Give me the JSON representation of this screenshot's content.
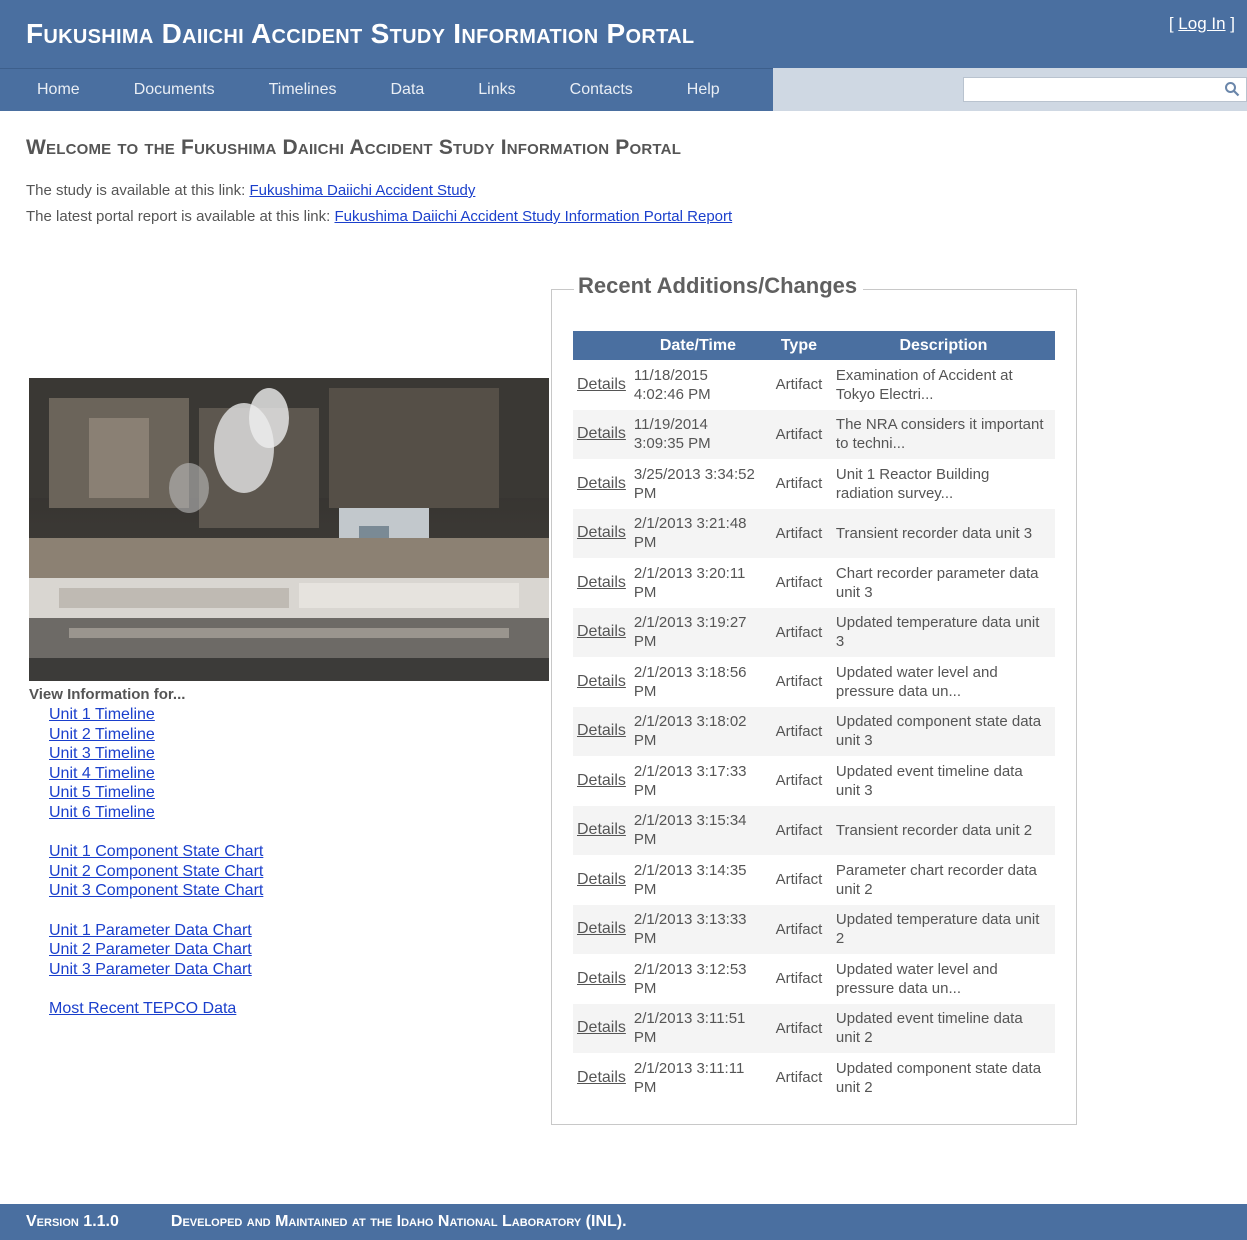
{
  "header": {
    "title": "Fukushima Daiichi Accident Study Information Portal",
    "login": "Log In"
  },
  "nav": {
    "items": [
      "Home",
      "Documents",
      "Timelines",
      "Data",
      "Links",
      "Contacts",
      "Help"
    ],
    "search_placeholder": ""
  },
  "main": {
    "heading": "Welcome to the Fukushima Daiichi Accident Study Information Portal",
    "study_text": "The study is available at this link: ",
    "study_link": "Fukushima Daiichi Accident Study",
    "report_text": "The latest portal report is available at this link: ",
    "report_link": "Fukushima Daiichi Accident Study Information Portal Report",
    "view_label": "View Information for...",
    "timelines": [
      "Unit 1 Timeline",
      "Unit 2 Timeline",
      "Unit 3 Timeline",
      "Unit 4 Timeline",
      "Unit 5 Timeline",
      "Unit 6 Timeline"
    ],
    "state_charts": [
      "Unit 1 Component State Chart",
      "Unit 2 Component State Chart",
      "Unit 3 Component State Chart"
    ],
    "param_charts": [
      "Unit 1 Parameter Data Chart",
      "Unit 2 Parameter Data Chart",
      "Unit 3 Parameter Data Chart"
    ],
    "tepco_link": "Most Recent TEPCO Data"
  },
  "recent": {
    "title": "Recent Additions/Changes",
    "columns": [
      "",
      "Date/Time",
      "Type",
      "Description"
    ],
    "rows": [
      {
        "link": "Details",
        "datetime": "11/18/2015 4:02:46 PM",
        "type": "Artifact",
        "description": "Examination of Accident at Tokyo Electri..."
      },
      {
        "link": "Details",
        "datetime": "11/19/2014 3:09:35 PM",
        "type": "Artifact",
        "description": "The NRA considers it important to techni..."
      },
      {
        "link": "Details",
        "datetime": "3/25/2013 3:34:52 PM",
        "type": "Artifact",
        "description": "Unit 1 Reactor Building radiation survey..."
      },
      {
        "link": "Details",
        "datetime": "2/1/2013 3:21:48 PM",
        "type": "Artifact",
        "description": "Transient recorder data unit 3"
      },
      {
        "link": "Details",
        "datetime": "2/1/2013 3:20:11 PM",
        "type": "Artifact",
        "description": "Chart recorder parameter data unit 3"
      },
      {
        "link": "Details",
        "datetime": "2/1/2013 3:19:27 PM",
        "type": "Artifact",
        "description": "Updated temperature data unit 3"
      },
      {
        "link": "Details",
        "datetime": "2/1/2013 3:18:56 PM",
        "type": "Artifact",
        "description": "Updated water level and pressure data un..."
      },
      {
        "link": "Details",
        "datetime": "2/1/2013 3:18:02 PM",
        "type": "Artifact",
        "description": "Updated component state data unit 3"
      },
      {
        "link": "Details",
        "datetime": "2/1/2013 3:17:33 PM",
        "type": "Artifact",
        "description": "Updated event timeline data unit 3"
      },
      {
        "link": "Details",
        "datetime": "2/1/2013 3:15:34 PM",
        "type": "Artifact",
        "description": "Transient recorder data unit 2"
      },
      {
        "link": "Details",
        "datetime": "2/1/2013 3:14:35 PM",
        "type": "Artifact",
        "description": "Parameter chart recorder data unit 2"
      },
      {
        "link": "Details",
        "datetime": "2/1/2013 3:13:33 PM",
        "type": "Artifact",
        "description": "Updated temperature data unit 2"
      },
      {
        "link": "Details",
        "datetime": "2/1/2013 3:12:53 PM",
        "type": "Artifact",
        "description": "Updated water level and pressure data un..."
      },
      {
        "link": "Details",
        "datetime": "2/1/2013 3:11:51 PM",
        "type": "Artifact",
        "description": "Updated event timeline data unit 2"
      },
      {
        "link": "Details",
        "datetime": "2/1/2013 3:11:11 PM",
        "type": "Artifact",
        "description": "Updated component state data unit 2"
      }
    ]
  },
  "footer": {
    "version": "Version 1.1.0",
    "developer": "Developed and Maintained at the Idaho National Laboratory (INL)."
  },
  "colors": {
    "header_bg": "#4a6fa0",
    "link": "#1a3fcc",
    "nav_strip": "#cfd8e3"
  }
}
